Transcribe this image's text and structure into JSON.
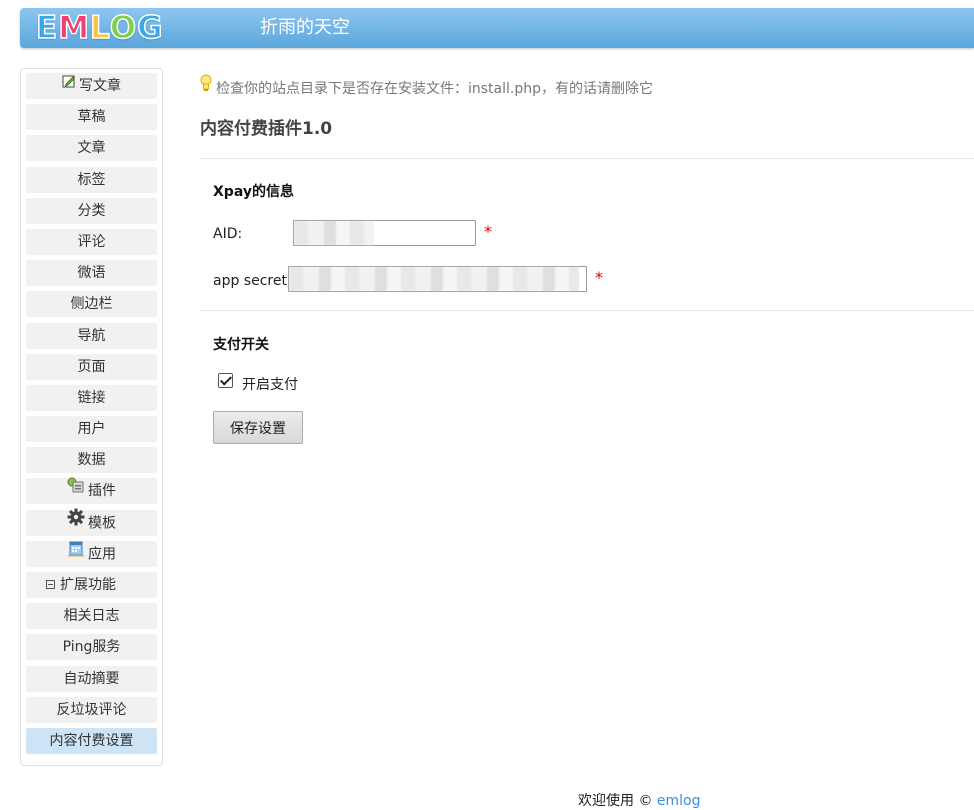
{
  "header": {
    "logo_letters": [
      "E",
      "M",
      "L",
      "O",
      "G"
    ],
    "logo_colors": [
      "#3aa8e8",
      "#ee3f6f",
      "#f6c342",
      "#7ad14a",
      "#3aa8e8"
    ],
    "site_title": "折雨的天空"
  },
  "sidebar": {
    "items": [
      {
        "label": "写文章",
        "icon": "edit-icon"
      },
      {
        "label": "草稿"
      },
      {
        "label": "文章"
      },
      {
        "label": "标签"
      },
      {
        "label": "分类"
      },
      {
        "label": "评论"
      },
      {
        "label": "微语"
      },
      {
        "label": "侧边栏"
      },
      {
        "label": "导航"
      },
      {
        "label": "页面"
      },
      {
        "label": "链接"
      },
      {
        "label": "用户"
      },
      {
        "label": "数据"
      },
      {
        "label": "插件",
        "icon": "plugin-icon"
      },
      {
        "label": "模板",
        "icon": "gear-icon"
      },
      {
        "label": "应用",
        "icon": "app-icon"
      },
      {
        "label": "扩展功能",
        "icon": "collapse-icon"
      },
      {
        "label": "相关日志"
      },
      {
        "label": "Ping服务"
      },
      {
        "label": "自动摘要"
      },
      {
        "label": "反垃圾评论"
      },
      {
        "label": "内容付费设置",
        "active": true
      }
    ]
  },
  "main": {
    "tip": "检查你的站点目录下是否存在安装文件：install.php，有的话请删除它",
    "page_title": "内容付费插件1.0",
    "section1_title": "Xpay的信息",
    "aid_label": "AID:",
    "secret_label": "app secret",
    "required_mark": "*",
    "section2_title": "支付开关",
    "enable_label": "开启支付",
    "enable_checked": true,
    "save_label": "保存设置"
  },
  "footer": {
    "text": "欢迎使用 © ",
    "link": "emlog"
  }
}
